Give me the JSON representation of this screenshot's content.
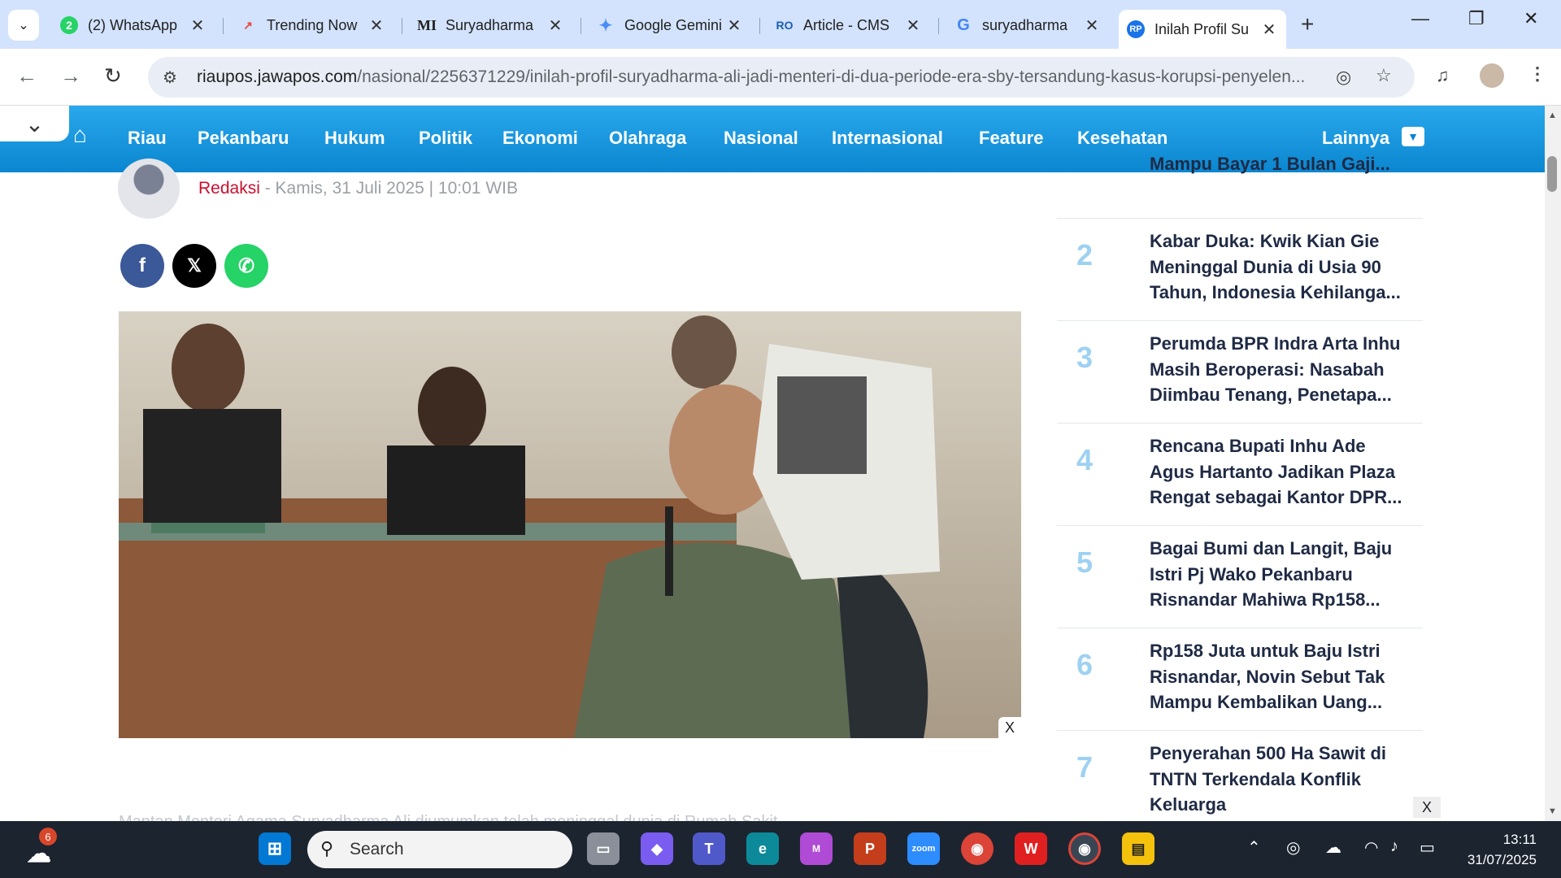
{
  "browser": {
    "tabs": [
      {
        "title": "(2) WhatsApp",
        "favicon": "whatsapp-icon",
        "badge": "2"
      },
      {
        "title": "Trending Now",
        "favicon": "trends-icon"
      },
      {
        "title": "Suryadharma",
        "favicon": "MI"
      },
      {
        "title": "Google Gemini",
        "favicon": "gemini-icon"
      },
      {
        "title": "Article - CMS",
        "favicon": "RO"
      },
      {
        "title": "suryadharma",
        "favicon": "google-icon"
      },
      {
        "title": "Inilah Profil Su",
        "favicon": "RP",
        "active": true
      }
    ],
    "address_domain": "riaupos.jawapos.com",
    "address_path": "/nasional/2256371229/inilah-profil-suryadharma-ali-jadi-menteri-di-dua-periode-era-sby-tersandung-kasus-korupsi-penyelen..."
  },
  "site_nav": {
    "items": [
      "Riau",
      "Pekanbaru",
      "Hukum",
      "Politik",
      "Ekonomi",
      "Olahraga",
      "Nasional",
      "Internasional",
      "Feature",
      "Kesehatan"
    ],
    "more_label": "Lainnya"
  },
  "article": {
    "author": "Redaksi",
    "date": " - Kamis, 31 Juli 2025 | 10:01 WIB",
    "photo_close": "X",
    "teaser": "Mantan Menteri Agama Suryadharma Ali diumumkan telah meninggal dunia di Rumah Sakit"
  },
  "sidebar": {
    "top_partial": "Mampu Bayar 1 Bulan Gaji...",
    "items": [
      {
        "rank": "2",
        "title": "Kabar Duka: Kwik Kian Gie Meninggal Dunia di Usia 90 Tahun, Indonesia Kehilanga..."
      },
      {
        "rank": "3",
        "title": "Perumda BPR Indra Arta Inhu Masih Beroperasi: Nasabah Diimbau Tenang, Penetapa..."
      },
      {
        "rank": "4",
        "title": "Rencana Bupati Inhu Ade Agus Hartanto Jadikan Plaza Rengat sebagai Kantor DPR..."
      },
      {
        "rank": "5",
        "title": "Bagai Bumi dan Langit, Baju Istri Pj Wako Pekanbaru Risnandar Mahiwa Rp158..."
      },
      {
        "rank": "6",
        "title": "Rp158 Juta untuk Baju Istri Risnandar, Novin Sebut Tak Mampu Kembalikan Uang..."
      },
      {
        "rank": "7",
        "title": "Penyerahan 500 Ha Sawit di TNTN Terkendala Konflik Keluarga"
      }
    ],
    "close": "X"
  },
  "taskbar": {
    "search_label": "Search",
    "weather_badge": "6",
    "time": "13:11",
    "date": "31/07/2025"
  }
}
